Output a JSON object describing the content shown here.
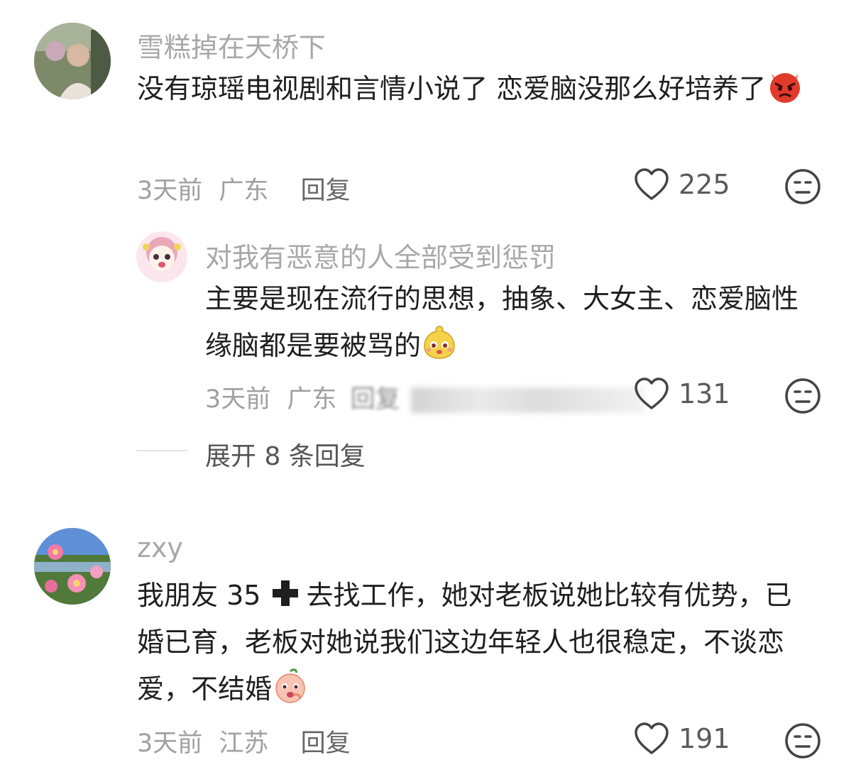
{
  "comments": [
    {
      "username": "雪糕掉在天桥下",
      "text": "没有琼瑶电视剧和言情小说了 恋爱脑没那么好培养了",
      "time": "3天前",
      "location": "广东",
      "reply_label": "回复",
      "likes": "225",
      "emoji": "angry-face-emoji"
    },
    {
      "username": "对我有恶意的人全部受到惩罚",
      "text": "主要是现在流行的思想，抽象、大女主、恋爱脑性缘脑都是要被骂的",
      "time": "3天前",
      "location": "广东",
      "reply_label": "回复",
      "likes": "131",
      "emoji": "yellow-blob-emoji"
    },
    {
      "username": "zxy",
      "text_before_icon": "我朋友 35 ",
      "text": "去找工作，她对老板说她比较有优势，已婚已育，老板对她说我们这边年轻人也很稳定，不谈恋爱，不结婚",
      "time": "3天前",
      "location": "江苏",
      "reply_label": "回复",
      "likes": "191",
      "emoji": "peach-face-emoji"
    }
  ],
  "expand_replies": "展开 8 条回复",
  "colors": {
    "muted": "#a8a8a8",
    "text": "#1f1f1f",
    "icon": "#444444"
  }
}
